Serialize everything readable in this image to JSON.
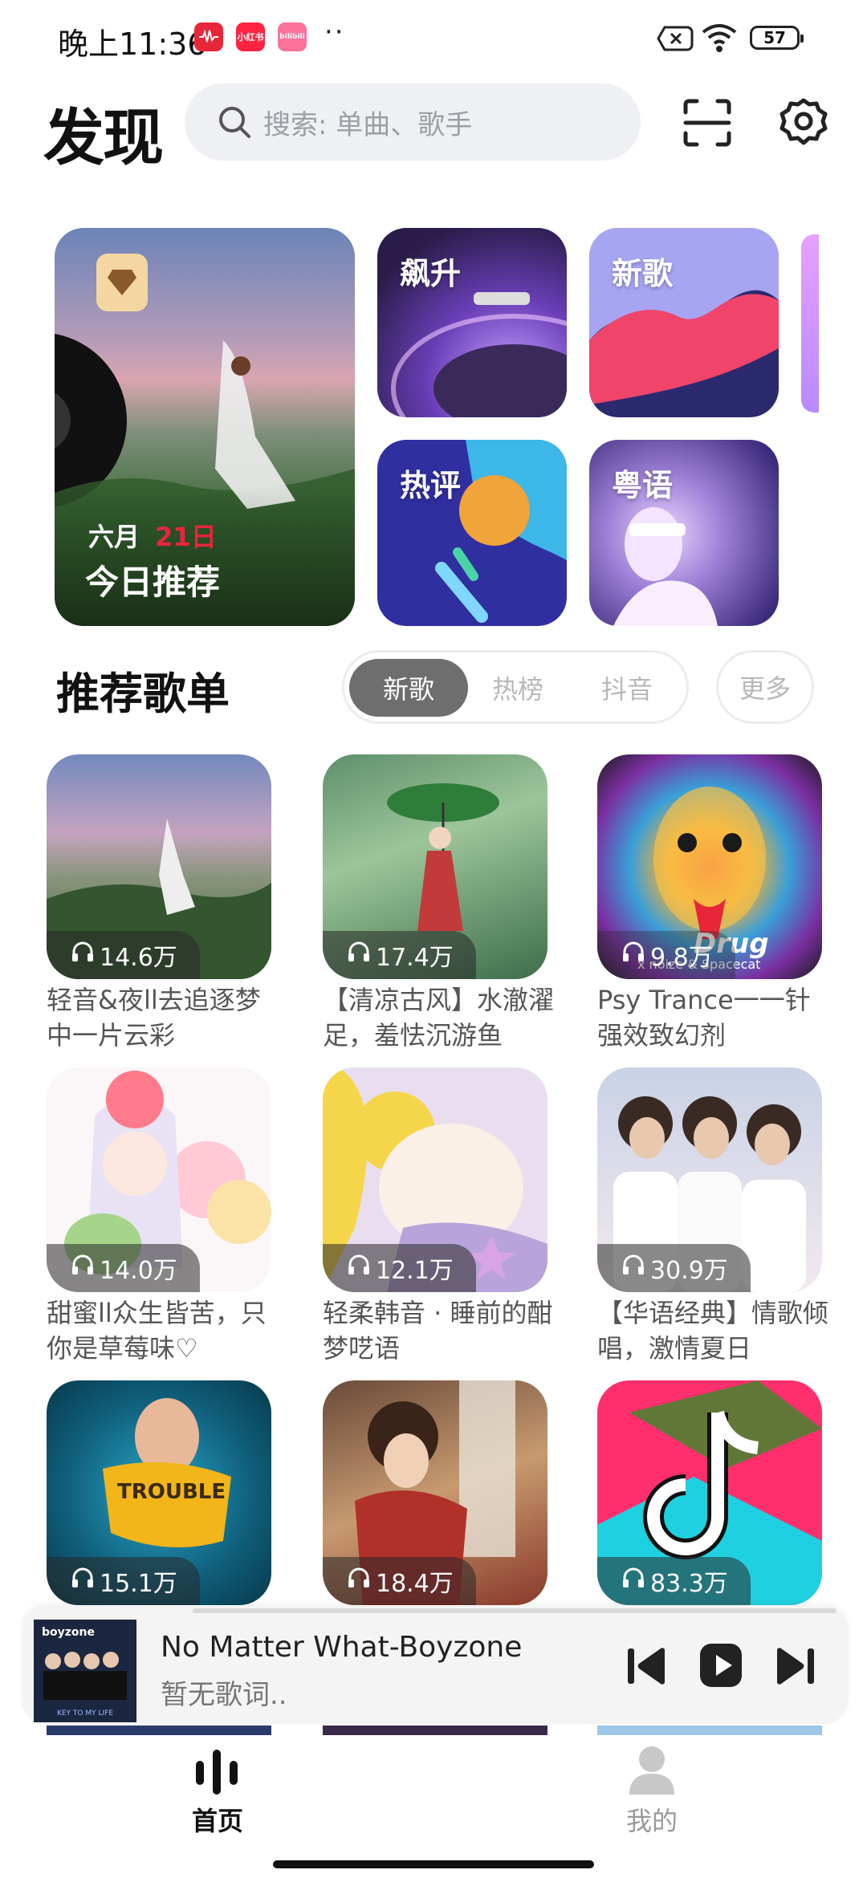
{
  "status_bar": {
    "time": "晚上11:36",
    "apps": [
      "netease-music-icon",
      "xiaohongshu-icon",
      "bilibili-icon"
    ],
    "app_labels": {
      "xhs": "小红书",
      "bili": "bilibili"
    },
    "more_dots": "··",
    "battery": "57"
  },
  "header": {
    "title": "发现",
    "search_placeholder": "搜索: 单曲、歌手"
  },
  "featured": {
    "daily_month": "六月",
    "daily_day": "21日",
    "daily_label": "今日推荐",
    "tiles": [
      {
        "label": "飙升"
      },
      {
        "label": "新歌"
      },
      {
        "label": "热评"
      },
      {
        "label": "粤语"
      }
    ]
  },
  "playlists_section": {
    "title": "推荐歌单",
    "tabs": [
      "新歌",
      "热榜",
      "抖音"
    ],
    "active_tab": "新歌",
    "more": "更多"
  },
  "playlists": [
    {
      "plays": "14.6万",
      "title": "轻音&夜ll去追逐梦中一片云彩"
    },
    {
      "plays": "17.4万",
      "title": "【清凉古风】水澈濯足，羞怯沉游鱼"
    },
    {
      "plays": "9.8万",
      "title": "Psy Trance一一针强效致幻剂",
      "overlay_text": "Drug",
      "overlay_sub": "x noize & Spacecat"
    },
    {
      "plays": "14.0万",
      "title": "甜蜜ll众生皆苦，只你是草莓味♡"
    },
    {
      "plays": "12.1万",
      "title": "轻柔韩音 · 睡前的酣梦呓语"
    },
    {
      "plays": "30.9万",
      "title": "【华语经典】情歌倾唱，激情夏日"
    },
    {
      "plays": "15.1万",
      "title": "",
      "overlay_text": "TROUBLE"
    },
    {
      "plays": "18.4万",
      "title": ""
    },
    {
      "plays": "83.3万",
      "title": ""
    }
  ],
  "player": {
    "album_label": "boyzone",
    "album_footer": "KEY TO MY LIFE",
    "song": "No Matter What-Boyzone",
    "lyric": "暂无歌词.."
  },
  "bottom_nav": {
    "home": "首页",
    "me": "我的"
  },
  "colors": {
    "accent_red": "#e8263a",
    "tab_active_bg": "#6e6e6e",
    "search_bg": "#eff0f3"
  }
}
